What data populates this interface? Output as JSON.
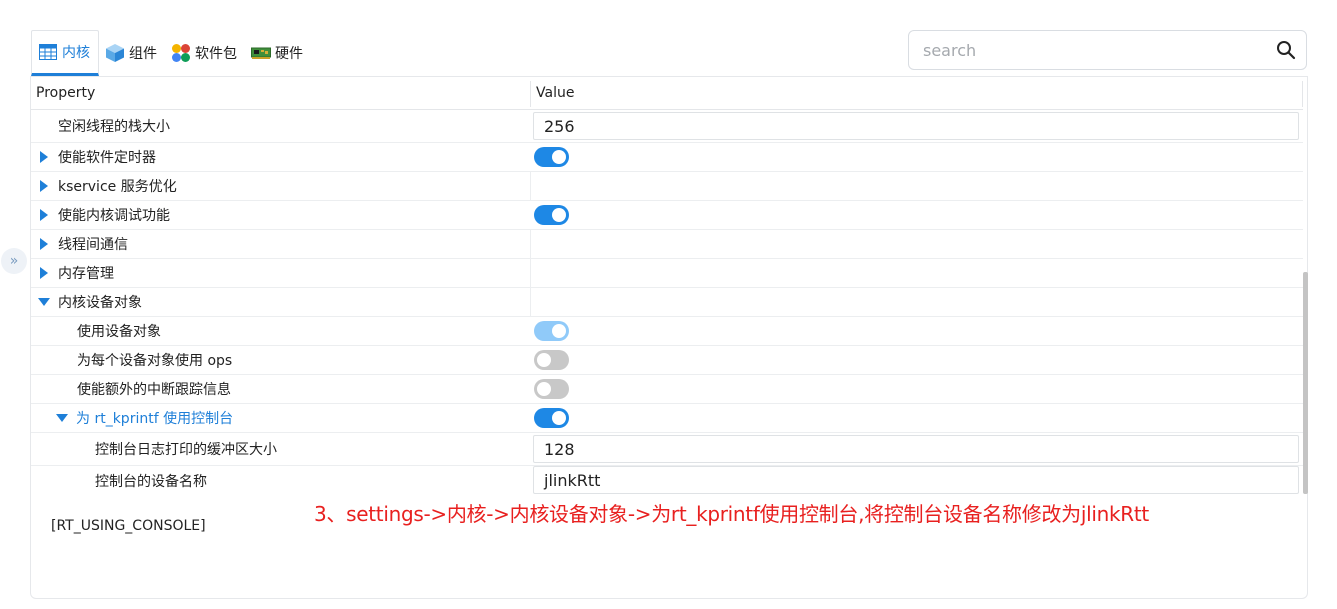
{
  "tabs": [
    {
      "label": "内核",
      "icon": "table-icon",
      "active": true
    },
    {
      "label": "组件",
      "icon": "cube-icon",
      "active": false
    },
    {
      "label": "软件包",
      "icon": "grid-color-icon",
      "active": false
    },
    {
      "label": "硬件",
      "icon": "board-icon",
      "active": false
    }
  ],
  "search": {
    "placeholder": "search",
    "value": ""
  },
  "grid": {
    "header": {
      "property": "Property",
      "value": "Value"
    },
    "rows": [
      {
        "label": "空闲线程的栈大小",
        "type": "input",
        "value": "256",
        "indent": 1,
        "expander": "none"
      },
      {
        "label": "使能软件定时器",
        "type": "toggle",
        "state": "on",
        "indent": 0,
        "expander": "collapsed"
      },
      {
        "label": "kservice 服务优化",
        "type": "none",
        "indent": 0,
        "expander": "collapsed"
      },
      {
        "label": "使能内核调试功能",
        "type": "toggle",
        "state": "on",
        "indent": 0,
        "expander": "collapsed"
      },
      {
        "label": "线程间通信",
        "type": "none",
        "indent": 0,
        "expander": "collapsed"
      },
      {
        "label": "内存管理",
        "type": "none",
        "indent": 0,
        "expander": "collapsed"
      },
      {
        "label": "内核设备对象",
        "type": "none",
        "indent": 0,
        "expander": "expanded"
      },
      {
        "label": "使用设备对象",
        "type": "toggle",
        "state": "disabled-on",
        "indent": 2,
        "expander": "none"
      },
      {
        "label": "为每个设备对象使用 ops",
        "type": "toggle",
        "state": "off",
        "indent": 2,
        "expander": "none"
      },
      {
        "label": "使能额外的中断跟踪信息",
        "type": "toggle",
        "state": "off",
        "indent": 2,
        "expander": "none"
      },
      {
        "label": "为 rt_kprintf 使用控制台",
        "type": "toggle",
        "state": "on",
        "indent": 1,
        "expander": "expanded",
        "selected": true
      },
      {
        "label": "控制台日志打印的缓冲区大小",
        "type": "input",
        "value": "128",
        "indent": 3,
        "expander": "none"
      },
      {
        "label": "控制台的设备名称",
        "type": "input",
        "value": "jlinkRtt",
        "indent": 3,
        "expander": "none"
      }
    ]
  },
  "footer": {
    "macro": "[RT_USING_CONSOLE]"
  },
  "annotation": {
    "text": "3、settings->内核->内核设备对象->为rt_kprintf使用控制台,将控制台设备名称修改为jlinkRtt",
    "color": "#e8201f"
  },
  "colors": {
    "accent": "#1e7fd8",
    "toggle_on": "#1e88e5",
    "toggle_off": "#c8c8c8"
  }
}
